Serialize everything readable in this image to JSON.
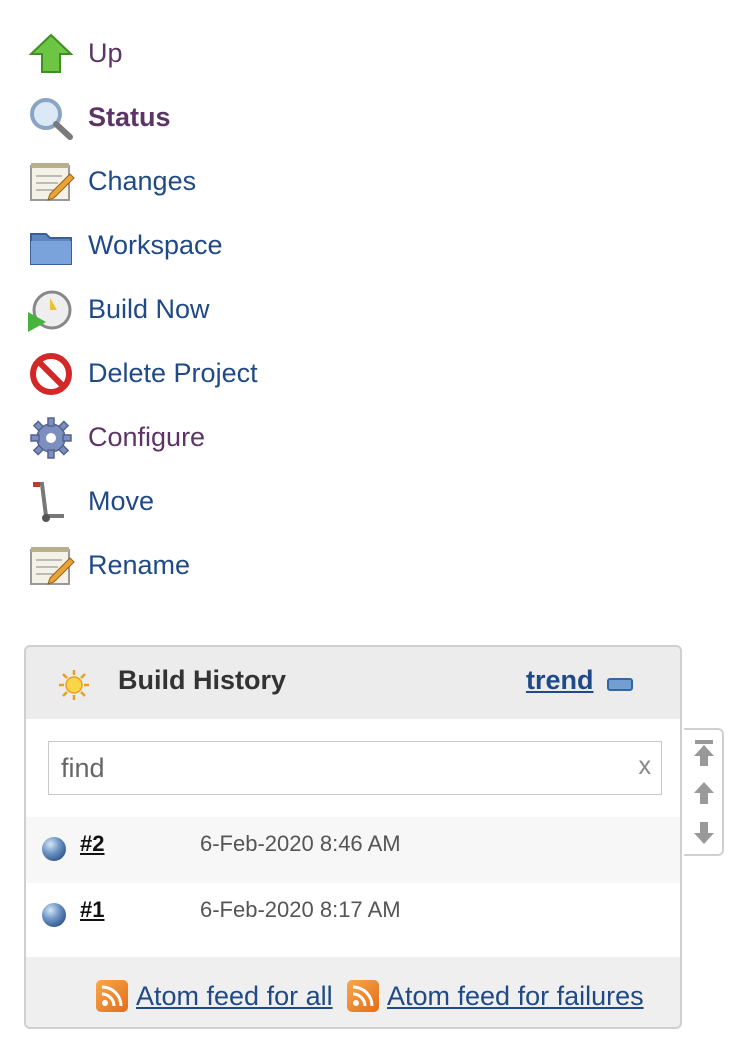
{
  "tasks": [
    {
      "label": "Up",
      "icon": "up-arrow-icon"
    },
    {
      "label": "Status",
      "icon": "search-icon"
    },
    {
      "label": "Changes",
      "icon": "notepad-icon"
    },
    {
      "label": "Workspace",
      "icon": "folder-icon"
    },
    {
      "label": "Build Now",
      "icon": "clock-play-icon"
    },
    {
      "label": "Delete Project",
      "icon": "no-entry-icon"
    },
    {
      "label": "Configure",
      "icon": "gear-icon"
    },
    {
      "label": "Move",
      "icon": "hand-truck-icon"
    },
    {
      "label": "Rename",
      "icon": "notepad-icon"
    }
  ],
  "build_history": {
    "title": "Build History",
    "trend_label": "trend",
    "search": {
      "placeholder": "find",
      "value": "",
      "clear_label": "x"
    },
    "builds": [
      {
        "number": "#2",
        "time": "6-Feb-2020 8:46 AM",
        "status": "success"
      },
      {
        "number": "#1",
        "time": "6-Feb-2020 8:17 AM",
        "status": "success"
      }
    ],
    "feeds": {
      "all_label": "Atom feed for all",
      "failures_label": "Atom feed for failures"
    }
  },
  "colors": {
    "link": "#204a87",
    "visited": "#5c3566",
    "status_ball": "#4a74b0"
  }
}
